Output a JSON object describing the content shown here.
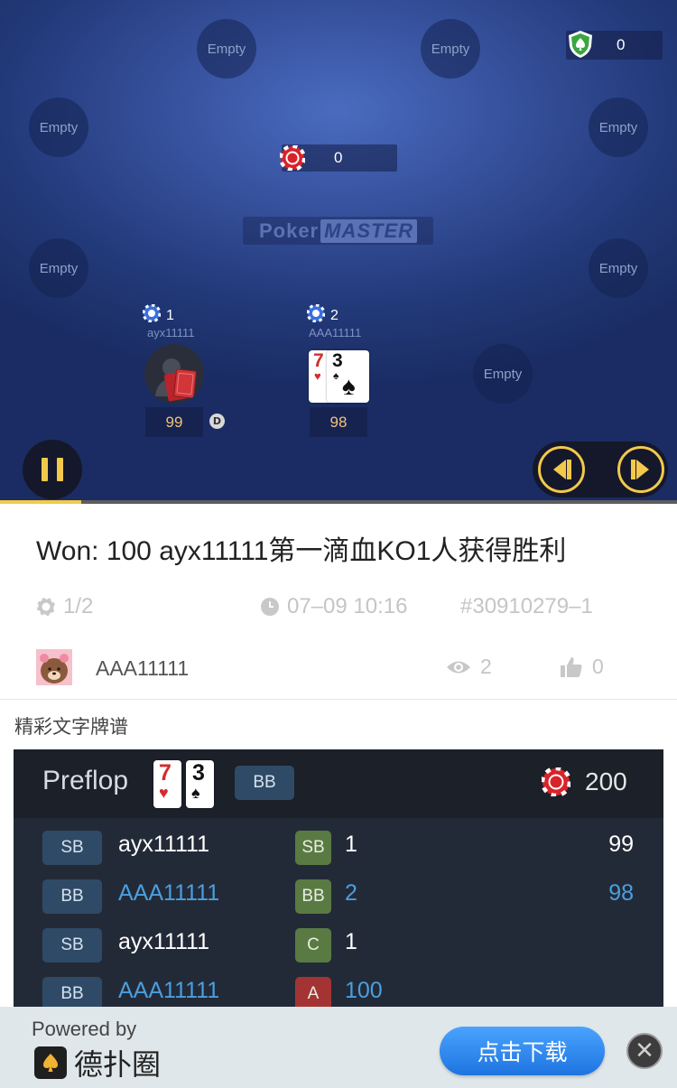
{
  "table": {
    "empty_seat_label": "Empty",
    "shield_count": "0",
    "pot": "0",
    "logo_part1": "Poker",
    "logo_part2": "MASTER",
    "dealer_label": "D",
    "players": [
      {
        "name": "ayx11111",
        "bet": "1",
        "stack": "99"
      },
      {
        "name": "AAA11111",
        "bet": "2",
        "stack": "98",
        "cards": [
          "7",
          "3"
        ]
      }
    ],
    "progress_fraction": 0.12
  },
  "info": {
    "won_title": "Won: 100   ayx11111第一滴血KO1人获得胜利",
    "blinds": "1/2",
    "datetime": "07–09 10:16",
    "hand_id": "#30910279–1",
    "username": "AAA11111",
    "views": "2",
    "likes": "0",
    "section_title": "精彩文字牌谱"
  },
  "log": {
    "street": "Preflop",
    "hero_cards": [
      "7",
      "3"
    ],
    "hero_position": "BB",
    "pot": "200",
    "rows": [
      {
        "position": "SB",
        "player": "ayx11111",
        "action": "SB",
        "amount": "1",
        "stack": "99"
      },
      {
        "position": "BB",
        "player": "AAA11111",
        "action": "BB",
        "amount": "2",
        "stack": "98"
      },
      {
        "position": "SB",
        "player": "ayx11111",
        "action": "C",
        "amount": "1",
        "stack": ""
      },
      {
        "position": "BB",
        "player": "AAA11111",
        "action": "A",
        "amount": "100",
        "stack": ""
      }
    ]
  },
  "footer": {
    "powered_by": "Powered by",
    "brand": "德扑圈",
    "download": "点击下载",
    "close": "✕"
  },
  "colors": {
    "accent_yellow": "#f2c94c",
    "hero_blue": "#4a9fe0",
    "action_green": "#5a7a44",
    "action_red": "#a43434"
  }
}
